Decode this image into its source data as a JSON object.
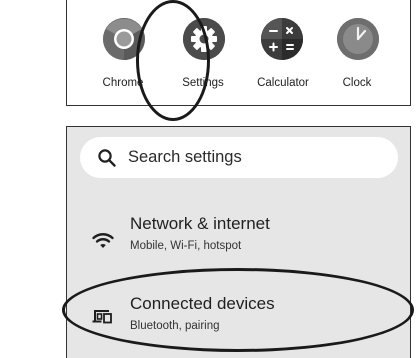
{
  "launcher": {
    "apps": [
      {
        "label": "Chrome",
        "icon": "chrome-icon"
      },
      {
        "label": "Settings",
        "icon": "gear-icon"
      },
      {
        "label": "Calculator",
        "icon": "calculator-icon"
      },
      {
        "label": "Clock",
        "icon": "clock-icon"
      }
    ],
    "highlighted_app": "Settings"
  },
  "settings": {
    "search": {
      "placeholder": "Search settings",
      "icon": "search-icon"
    },
    "items": [
      {
        "title": "Network & internet",
        "subtitle": "Mobile, Wi-Fi, hotspot",
        "icon": "wifi-icon"
      },
      {
        "title": "Connected devices",
        "subtitle": "Bluetooth, pairing",
        "icon": "connected-devices-icon"
      }
    ],
    "highlighted_item": "Connected devices"
  }
}
